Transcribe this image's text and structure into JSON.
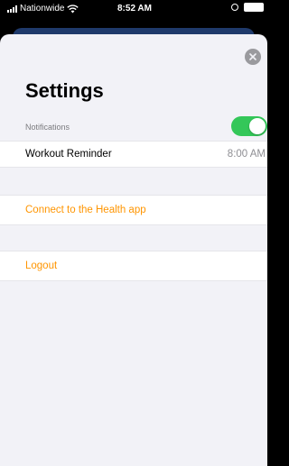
{
  "status_bar": {
    "carrier": "Nationwide",
    "time": "8:52 AM"
  },
  "settings": {
    "title": "Settings",
    "notifications_label": "Notifications",
    "notifications_enabled": true,
    "workout_reminder_label": "Workout Reminder",
    "workout_reminder_time": "8:00 AM",
    "health_link_label": "Connect to the Health app",
    "logout_label": "Logout"
  },
  "colors": {
    "accent": "#ff9500",
    "toggle_on": "#34c759",
    "background": "#f2f2f7"
  }
}
